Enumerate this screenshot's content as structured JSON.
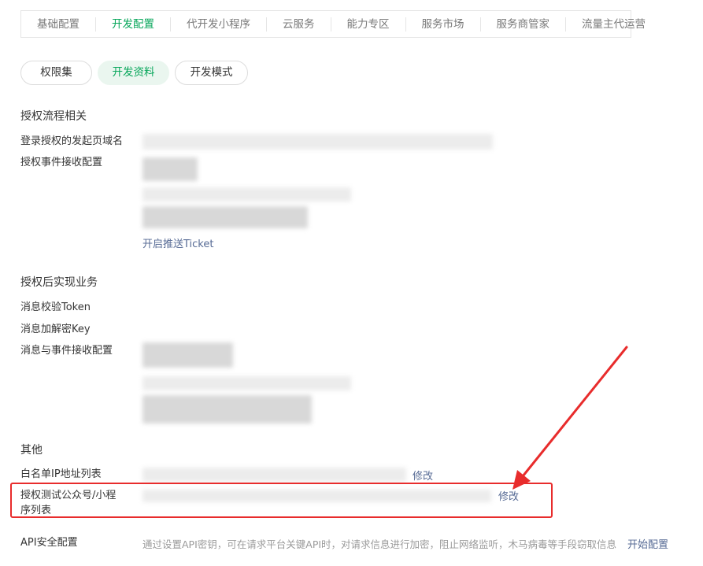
{
  "tabs": [
    {
      "label": "基础配置",
      "active": false
    },
    {
      "label": "开发配置",
      "active": true
    },
    {
      "label": "代开发小程序",
      "active": false
    },
    {
      "label": "云服务",
      "active": false
    },
    {
      "label": "能力专区",
      "active": false
    },
    {
      "label": "服务市场",
      "active": false
    },
    {
      "label": "服务商管家",
      "active": false
    },
    {
      "label": "流量主代运营",
      "active": false
    }
  ],
  "subtabs": {
    "permission": "权限集",
    "dev_data": "开发资料",
    "dev_mode": "开发模式"
  },
  "auth_flow": {
    "title": "授权流程相关",
    "domain_label": "登录授权的发起页域名",
    "event_label": "授权事件接收配置",
    "ticket_link": "开启推送Ticket"
  },
  "post_auth": {
    "title": "授权后实现业务",
    "token_label": "消息校验Token",
    "key_label": "消息加解密Key",
    "event_label": "消息与事件接收配置"
  },
  "other": {
    "title": "其他",
    "whitelist_label": "白名单IP地址列表",
    "whitelist_edit": "修改",
    "test_list_label_1": "授权测试公众号/小程",
    "test_list_label_2": "序列表",
    "test_list_edit": "修改",
    "api_label": "API安全配置",
    "api_hint": "通过设置API密钥，可在请求平台关键API时，对请求信息进行加密，阻止网络监听，木马病毒等手段窃取信息",
    "api_link": "开始配置"
  },
  "colors": {
    "accent": "#07a65a",
    "link": "#576b95",
    "annotation": "#e82c2c"
  }
}
